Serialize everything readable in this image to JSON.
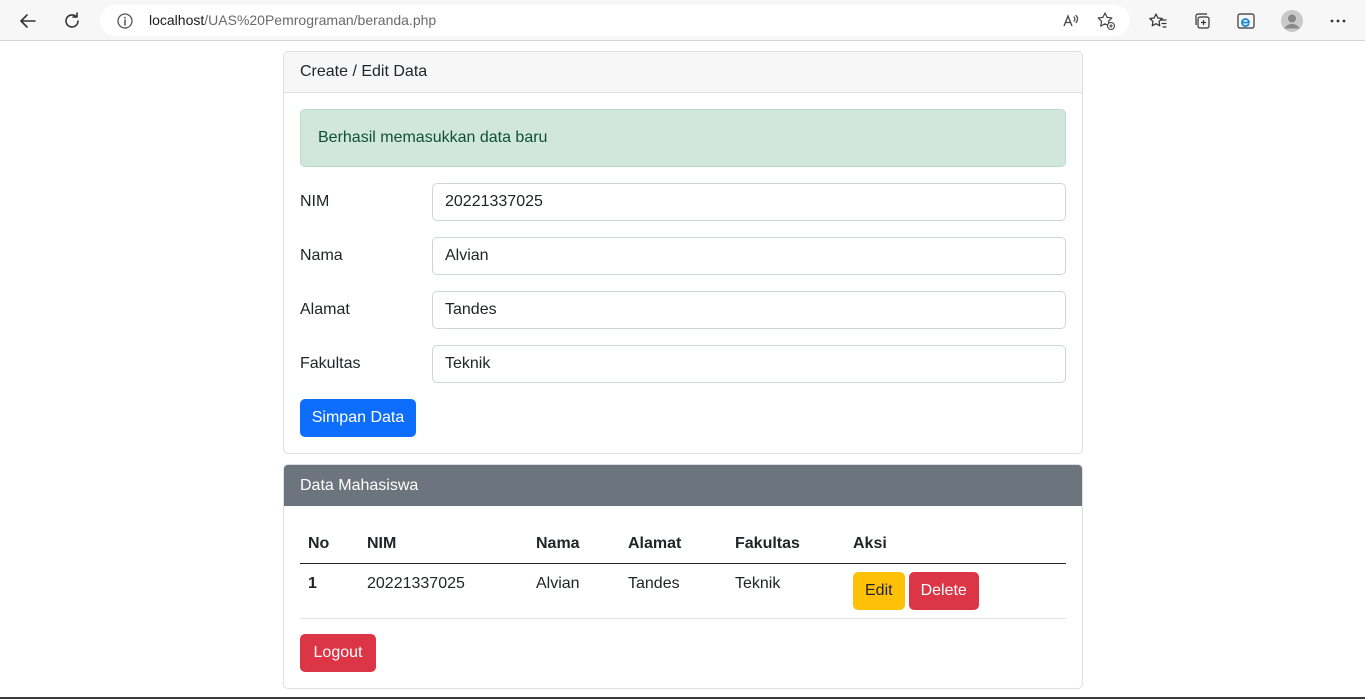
{
  "browser": {
    "url_host": "localhost",
    "url_path": "/UAS%20Pemrograman/beranda.php"
  },
  "form_card": {
    "header": "Create / Edit Data",
    "alert": "Berhasil memasukkan data baru",
    "fields": [
      {
        "label": "NIM",
        "value": "20221337025"
      },
      {
        "label": "Nama",
        "value": "Alvian"
      },
      {
        "label": "Alamat",
        "value": "Tandes"
      },
      {
        "label": "Fakultas",
        "value": "Teknik"
      }
    ],
    "submit_label": "Simpan Data"
  },
  "table_card": {
    "header": "Data Mahasiswa",
    "columns": [
      "No",
      "NIM",
      "Nama",
      "Alamat",
      "Fakultas",
      "Aksi"
    ],
    "rows": [
      {
        "no": "1",
        "nim": "20221337025",
        "nama": "Alvian",
        "alamat": "Tandes",
        "fakultas": "Teknik",
        "edit": "Edit",
        "delete": "Delete"
      }
    ],
    "logout_label": "Logout"
  },
  "colors": {
    "primary": "#0d6efd",
    "warning": "#ffc107",
    "danger": "#dc3545",
    "secondary": "#6c757d",
    "success_bg": "#d1e7dd",
    "success_text": "#0f5132"
  }
}
